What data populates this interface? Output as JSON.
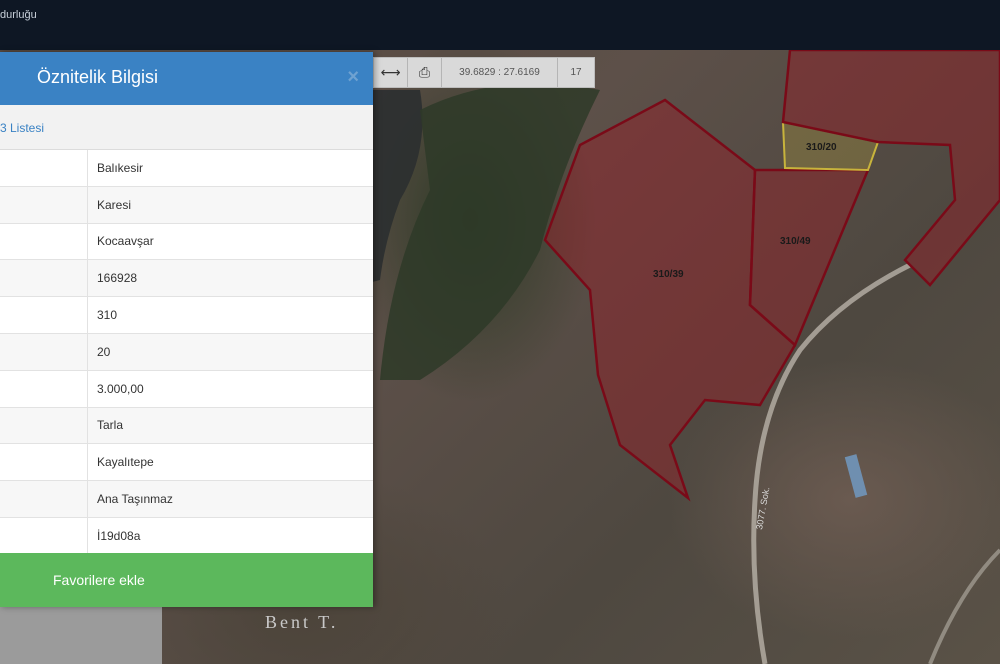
{
  "app": {
    "title_fragment": "durluğu"
  },
  "map": {
    "coords": "39.6829 : 27.6169",
    "zoom": "17",
    "parcels": [
      "310/39",
      "310/49",
      "310/20"
    ],
    "road_label": "3077. Sok.",
    "place_label": "Bent T."
  },
  "panel": {
    "title": "Öznitelik Bilgisi",
    "close_glyph": "×",
    "list_link": "3 Listesi",
    "rows": [
      "Balıkesir",
      "Karesi",
      "Kocaavşar",
      "166928",
      "310",
      "20",
      "3.000,00",
      "Tarla",
      "Kayalıtepe",
      "Ana Taşınmaz",
      "İ19d08a"
    ],
    "favorite_button": "Favorilere ekle"
  }
}
